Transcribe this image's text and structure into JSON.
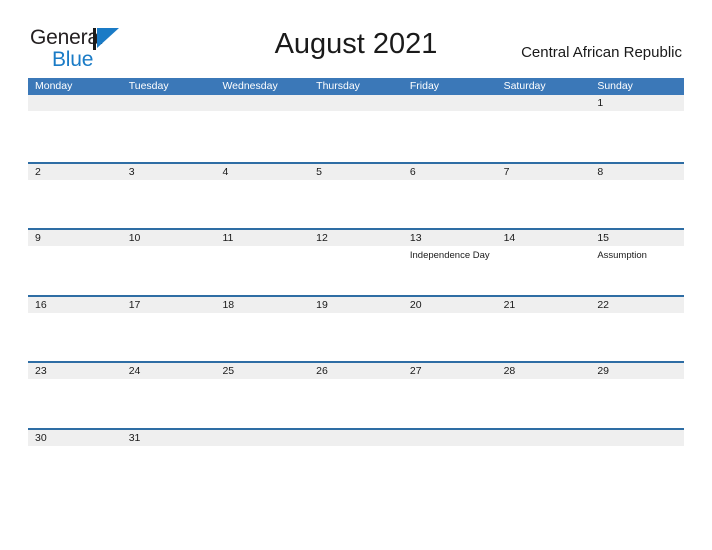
{
  "brand": {
    "name_part1": "General",
    "name_part2": "Blue",
    "mark_color": "#1a7bc6",
    "text_color": "#231f20"
  },
  "header": {
    "title": "August 2021",
    "country": "Central African Republic"
  },
  "theme": {
    "header_blue": "#3b78b8",
    "rule_blue": "#2e6da4",
    "date_band_gray": "#efefef",
    "page_background": "#ffffff",
    "text": "#1a1a1a"
  },
  "calendar": {
    "weekdays": [
      "Monday",
      "Tuesday",
      "Wednesday",
      "Thursday",
      "Friday",
      "Saturday",
      "Sunday"
    ],
    "weeks": [
      [
        {
          "date": "",
          "holiday": ""
        },
        {
          "date": "",
          "holiday": ""
        },
        {
          "date": "",
          "holiday": ""
        },
        {
          "date": "",
          "holiday": ""
        },
        {
          "date": "",
          "holiday": ""
        },
        {
          "date": "",
          "holiday": ""
        },
        {
          "date": "1",
          "holiday": ""
        }
      ],
      [
        {
          "date": "2",
          "holiday": ""
        },
        {
          "date": "3",
          "holiday": ""
        },
        {
          "date": "4",
          "holiday": ""
        },
        {
          "date": "5",
          "holiday": ""
        },
        {
          "date": "6",
          "holiday": ""
        },
        {
          "date": "7",
          "holiday": ""
        },
        {
          "date": "8",
          "holiday": ""
        }
      ],
      [
        {
          "date": "9",
          "holiday": ""
        },
        {
          "date": "10",
          "holiday": ""
        },
        {
          "date": "11",
          "holiday": ""
        },
        {
          "date": "12",
          "holiday": ""
        },
        {
          "date": "13",
          "holiday": "Independence Day"
        },
        {
          "date": "14",
          "holiday": ""
        },
        {
          "date": "15",
          "holiday": "Assumption"
        }
      ],
      [
        {
          "date": "16",
          "holiday": ""
        },
        {
          "date": "17",
          "holiday": ""
        },
        {
          "date": "18",
          "holiday": ""
        },
        {
          "date": "19",
          "holiday": ""
        },
        {
          "date": "20",
          "holiday": ""
        },
        {
          "date": "21",
          "holiday": ""
        },
        {
          "date": "22",
          "holiday": ""
        }
      ],
      [
        {
          "date": "23",
          "holiday": ""
        },
        {
          "date": "24",
          "holiday": ""
        },
        {
          "date": "25",
          "holiday": ""
        },
        {
          "date": "26",
          "holiday": ""
        },
        {
          "date": "27",
          "holiday": ""
        },
        {
          "date": "28",
          "holiday": ""
        },
        {
          "date": "29",
          "holiday": ""
        }
      ],
      [
        {
          "date": "30",
          "holiday": ""
        },
        {
          "date": "31",
          "holiday": ""
        },
        {
          "date": "",
          "holiday": ""
        },
        {
          "date": "",
          "holiday": ""
        },
        {
          "date": "",
          "holiday": ""
        },
        {
          "date": "",
          "holiday": ""
        },
        {
          "date": "",
          "holiday": ""
        }
      ]
    ]
  }
}
